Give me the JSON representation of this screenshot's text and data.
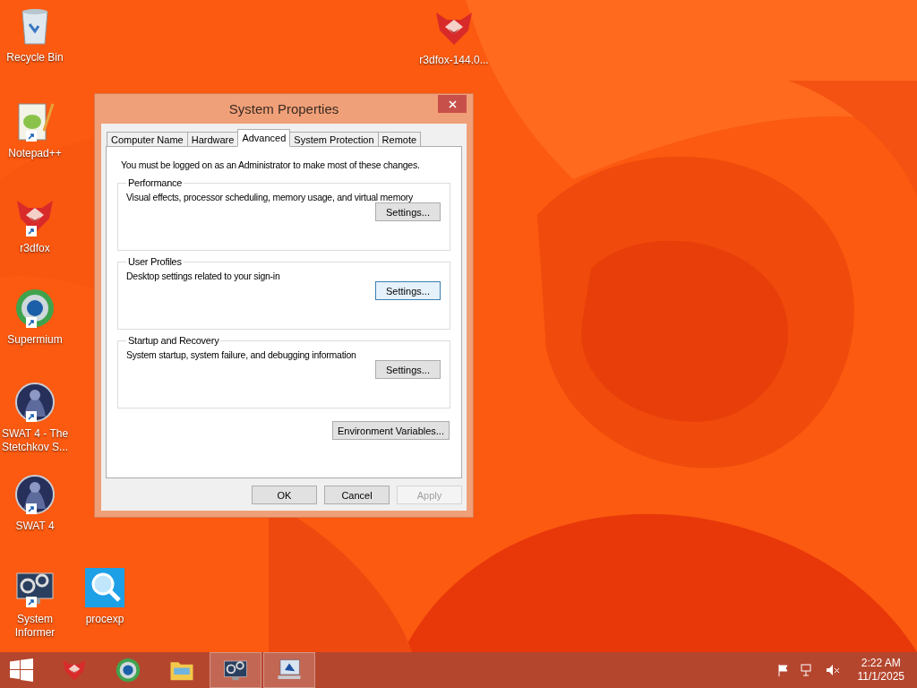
{
  "desktop_icons": [
    {
      "label": "Recycle Bin",
      "kind": "recycle",
      "shortcut": false
    },
    {
      "label": "r3dfox-144.0...",
      "kind": "fox",
      "shortcut": false
    },
    {
      "label": "Notepad++",
      "kind": "notepad",
      "shortcut": true
    },
    {
      "label": "r3dfox",
      "kind": "fox",
      "shortcut": true
    },
    {
      "label": "Supermium",
      "kind": "browser",
      "shortcut": true
    },
    {
      "label": "SWAT 4 - The Stetchkov S...",
      "kind": "game",
      "shortcut": true
    },
    {
      "label": "SWAT 4",
      "kind": "game",
      "shortcut": true
    },
    {
      "label": "System Informer",
      "kind": "sysinfo",
      "shortcut": true
    },
    {
      "label": "procexp",
      "kind": "search",
      "shortcut": false
    }
  ],
  "window": {
    "title": "System Properties",
    "tabs": [
      {
        "label": "Computer Name",
        "selected": false
      },
      {
        "label": "Hardware",
        "selected": false
      },
      {
        "label": "Advanced",
        "selected": true
      },
      {
        "label": "System Protection",
        "selected": false
      },
      {
        "label": "Remote",
        "selected": false
      }
    ],
    "note": "You must be logged on as an Administrator to make most of these changes.",
    "groups": [
      {
        "title": "Performance",
        "description": "Visual effects, processor scheduling, memory usage, and virtual memory",
        "button": "Settings...",
        "focused": false
      },
      {
        "title": "User Profiles",
        "description": "Desktop settings related to your sign-in",
        "button": "Settings...",
        "focused": true
      },
      {
        "title": "Startup and Recovery",
        "description": "System startup, system failure, and debugging information",
        "button": "Settings...",
        "focused": false
      }
    ],
    "env_button": "Environment Variables...",
    "buttons": [
      {
        "label": "OK",
        "disabled": false
      },
      {
        "label": "Cancel",
        "disabled": false
      },
      {
        "label": "Apply",
        "disabled": true
      }
    ]
  },
  "taskbar": {
    "apps": [
      {
        "kind": "fox",
        "active": false
      },
      {
        "kind": "browser",
        "active": false
      },
      {
        "kind": "folder",
        "active": false
      },
      {
        "kind": "sysinfo",
        "active": true
      },
      {
        "kind": "sysprops",
        "active": true
      }
    ],
    "time": "2:22 AM",
    "date": "11/1/2025"
  }
}
